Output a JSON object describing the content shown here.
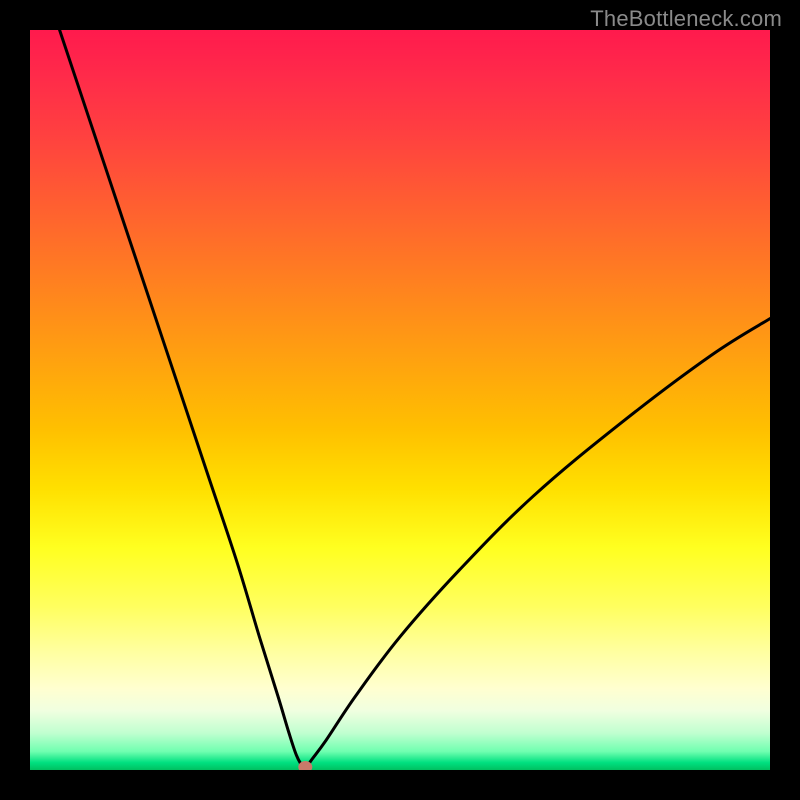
{
  "watermark": "TheBottleneck.com",
  "chart_data": {
    "type": "line",
    "title": "",
    "xlabel": "",
    "ylabel": "",
    "xlim": [
      0,
      100
    ],
    "ylim": [
      0,
      100
    ],
    "grid": false,
    "legend": false,
    "series": [
      {
        "name": "curve",
        "x": [
          4,
          8,
          12,
          16,
          20,
          24,
          28,
          31,
          33.5,
          35,
          36,
          36.8,
          37.2,
          37.4,
          38,
          40,
          44,
          50,
          58,
          68,
          80,
          92,
          100
        ],
        "y": [
          100,
          88,
          76,
          64,
          52,
          40,
          28,
          18,
          10,
          5,
          2,
          0.5,
          0,
          0.3,
          1.3,
          4,
          10,
          18,
          27,
          37,
          47,
          56,
          61
        ]
      }
    ],
    "marker": {
      "x": 37.2,
      "y": 0
    },
    "gradient_stops": [
      {
        "pos": 0,
        "color": "#ff1a4d"
      },
      {
        "pos": 0.5,
        "color": "#ffd000"
      },
      {
        "pos": 0.85,
        "color": "#ffff80"
      },
      {
        "pos": 1.0,
        "color": "#00c060"
      }
    ]
  }
}
